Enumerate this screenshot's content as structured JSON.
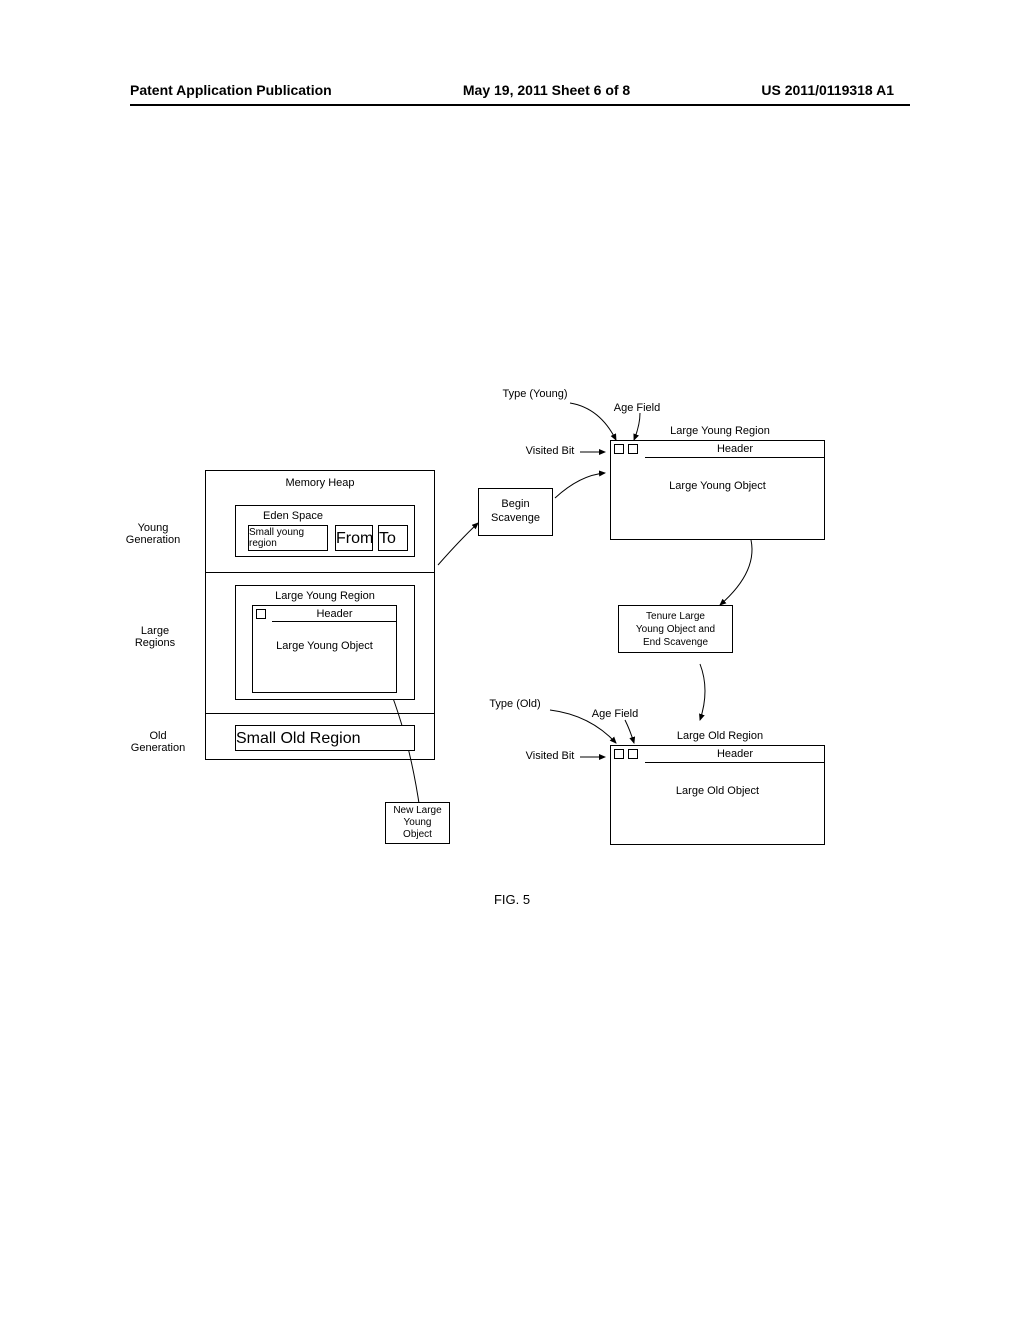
{
  "header": {
    "left": "Patent Application Publication",
    "center": "May 19, 2011  Sheet 6 of 8",
    "right": "US 2011/0119318 A1"
  },
  "labels": {
    "young_generation": "Young\nGeneration",
    "large_regions": "Large\nRegions",
    "old_generation": "Old\nGeneration",
    "memory_heap": "Memory Heap",
    "eden_space": "Eden Space",
    "small_young_region": "Small young\nregion",
    "from": "From",
    "to": "To",
    "large_young_region": "Large Young Region",
    "header_label": "Header",
    "large_young_object": "Large Young Object",
    "small_old_region": "Small Old Region",
    "new_large_young_object": "New Large\nYoung\nObject",
    "begin_scavenge": "Begin\nScavenge",
    "type_young": "Type (Young)",
    "type_old": "Type (Old)",
    "age_field": "Age Field",
    "visited_bit": "Visited Bit",
    "tenure": "Tenure Large\nYoung Object and\nEnd Scavenge",
    "large_old_region": "Large Old Region",
    "large_old_object": "Large Old Object"
  },
  "figure": "FIG. 5"
}
